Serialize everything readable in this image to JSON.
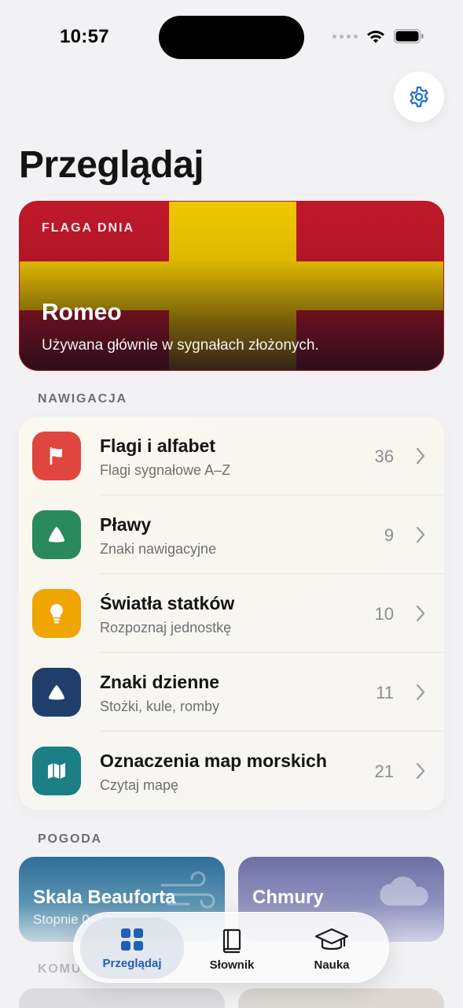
{
  "status_bar": {
    "time": "10:57"
  },
  "header": {
    "title": "Przeglądaj"
  },
  "flag_of_day": {
    "eyebrow": "FLAGA DNIA",
    "name": "Romeo",
    "description": "Używana głównie w sygnałach złożonych.",
    "colors": {
      "field": "#c0182b",
      "cross": "#f0c800"
    }
  },
  "navigation": {
    "section_label": "NAWIGACJA",
    "items": [
      {
        "title": "Flagi i alfabet",
        "subtitle": "Flagi sygnałowe A–Z",
        "count": "36",
        "icon": "flag-icon",
        "color": "#e0463f"
      },
      {
        "title": "Pławy",
        "subtitle": "Znaki nawigacyjne",
        "count": "9",
        "icon": "buoy-icon",
        "color": "#2a8a5b"
      },
      {
        "title": "Światła statków",
        "subtitle": "Rozpoznaj jednostkę",
        "count": "10",
        "icon": "lightbulb-icon",
        "color": "#f0a500"
      },
      {
        "title": "Znaki dzienne",
        "subtitle": "Stożki, kule, romby",
        "count": "11",
        "icon": "triangle-icon",
        "color": "#1f3e6b"
      },
      {
        "title": "Oznaczenia map morskich",
        "subtitle": "Czytaj mapę",
        "count": "21",
        "icon": "map-icon",
        "color": "#1b7f86"
      }
    ]
  },
  "weather": {
    "section_label": "POGODA",
    "cards": [
      {
        "title": "Skala Beauforta",
        "subtitle": "Stopnie 0–12",
        "icon": "wind-icon"
      },
      {
        "title": "Chmury",
        "subtitle": "",
        "icon": "cloud-icon"
      }
    ]
  },
  "next_section": {
    "label": "KOMU"
  },
  "tab_bar": {
    "tabs": [
      {
        "label": "Przeglądaj",
        "icon": "grid-icon",
        "active": true
      },
      {
        "label": "Słownik",
        "icon": "book-icon",
        "active": false
      },
      {
        "label": "Nauka",
        "icon": "graduation-cap-icon",
        "active": false
      }
    ]
  },
  "accent": "#1f6fd1"
}
